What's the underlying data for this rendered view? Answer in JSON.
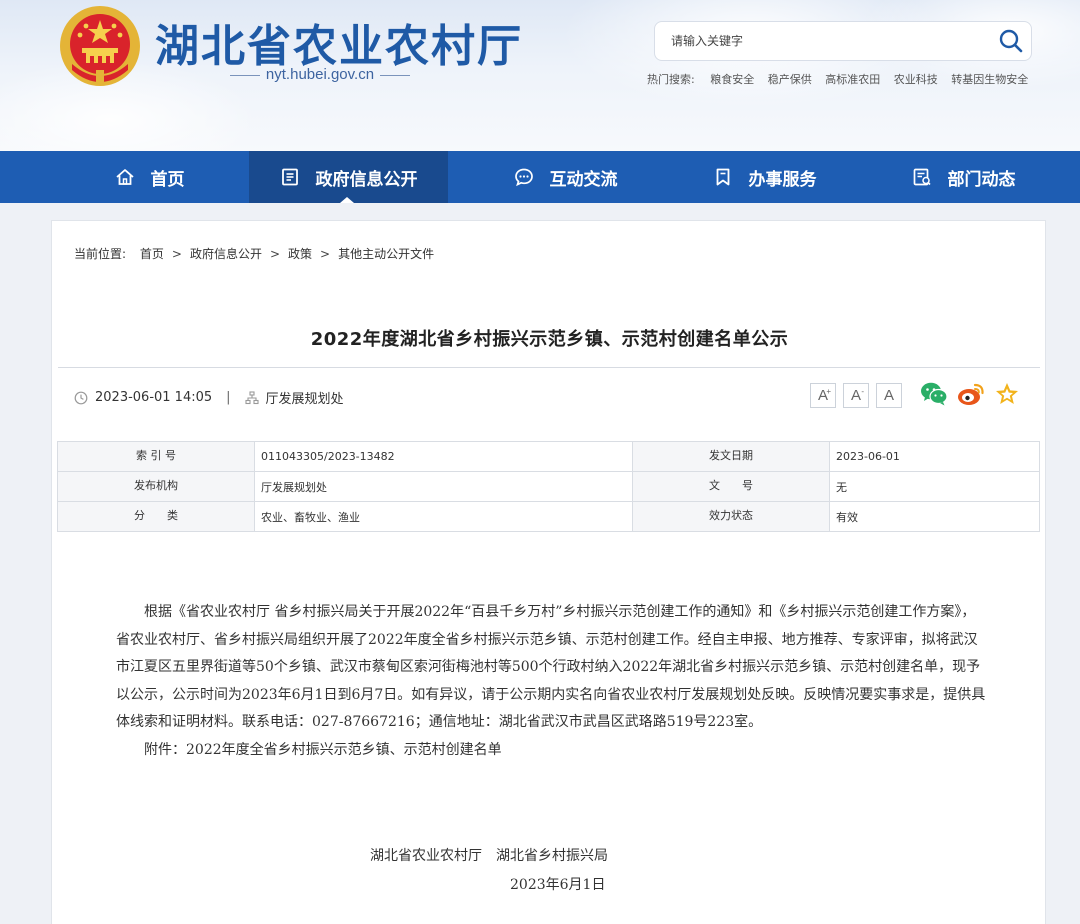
{
  "header": {
    "site_title": "湖北省农业农村厅",
    "site_domain": "nyt.hubei.gov.cn",
    "search_placeholder": "请输入关键字",
    "hot_search_label": "热门搜索:",
    "hot_search_items": [
      "粮食安全",
      "稳产保供",
      "高标准农田",
      "农业科技",
      "转基因生物安全"
    ]
  },
  "nav": {
    "items": [
      {
        "label": "首页",
        "icon": "home-icon"
      },
      {
        "label": "政府信息公开",
        "icon": "document-icon",
        "active": true
      },
      {
        "label": "互动交流",
        "icon": "chat-icon"
      },
      {
        "label": "办事服务",
        "icon": "bookmark-icon"
      },
      {
        "label": "部门动态",
        "icon": "report-icon"
      }
    ]
  },
  "breadcrumb": {
    "label": "当前位置:",
    "items": [
      "首页",
      "政府信息公开",
      "政策",
      "其他主动公开文件"
    ],
    "separator": ">"
  },
  "article": {
    "title": "2022年度湖北省乡村振兴示范乡镇、示范村创建名单公示",
    "date": "2023-06-01 14:05",
    "meta_separator": "|",
    "department": "厅发展规划处",
    "font_sizes": [
      "A",
      "A",
      "A"
    ],
    "font_size_plus": "+",
    "font_size_minus": "-"
  },
  "info_table": {
    "rows": [
      {
        "k1": "索 引 号",
        "v1": "011043305/2023-13482",
        "k2": "发文日期",
        "v2": "2023-06-01"
      },
      {
        "k1": "发布机构",
        "v1": "厅发展规划处",
        "k2": "文　　号",
        "v2": "无"
      },
      {
        "k1": "分　　类",
        "v1": "农业、畜牧业、渔业",
        "k2": "效力状态",
        "v2": "有效"
      }
    ]
  },
  "body": {
    "paragraph1": "根据《省农业农村厅 省乡村振兴局关于开展2022年“百县千乡万村”乡村振兴示范创建工作的通知》和《乡村振兴示范创建工作方案》，省农业农村厅、省乡村振兴局组织开展了2022年度全省乡村振兴示范乡镇、示范村创建工作。经自主申报、地方推荐、专家评审，拟将武汉市江夏区五里界街道等50个乡镇、武汉市蔡甸区索河街梅池村等500个行政村纳入2022年湖北省乡村振兴示范乡镇、示范村创建名单，现予以公示，公示时间为2023年6月1日到6月7日。如有异议，请于公示期内实名向省农业农村厅发展规划处反映。反映情况要实事求是，提供具体线索和证明材料。联系电话：027-87667216；通信地址：湖北省武汉市武昌区武珞路519号223室。",
    "attachment": "附件：2022年度全省乡村振兴示范乡镇、示范村创建名单",
    "signature_orgs": "湖北省农业农村厅　湖北省乡村振兴局",
    "signature_date": "2023年6月1日"
  },
  "colors": {
    "nav_bg": "#1e5db3",
    "nav_active": "#194a8e",
    "title_blue": "#1f5aa6",
    "wechat_green": "#2aae67",
    "weibo_orange": "#e8561a",
    "star_yellow": "#f2b31b"
  }
}
